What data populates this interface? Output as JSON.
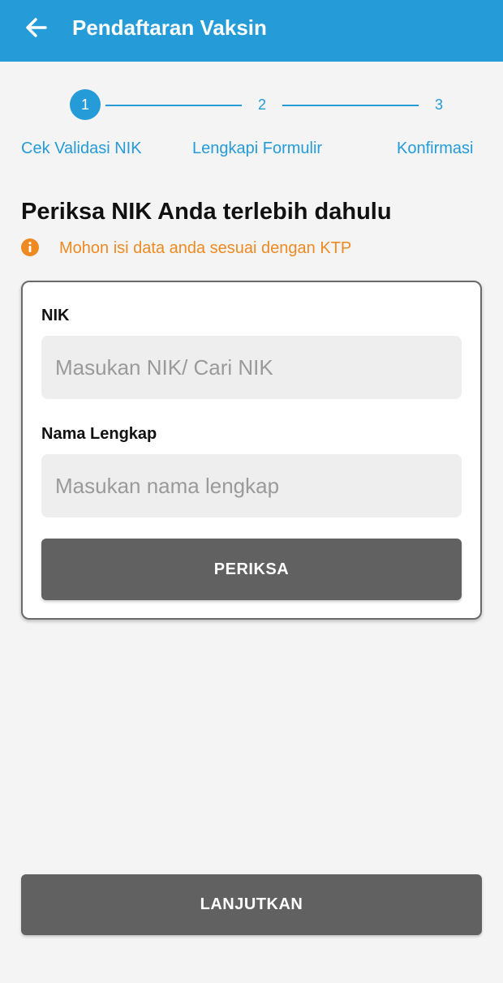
{
  "appbar": {
    "title": "Pendaftaran Vaksin",
    "back_icon": "arrow-left-icon",
    "color": "#259bd8"
  },
  "stepper": {
    "current_step": 1,
    "steps": [
      {
        "number": "1",
        "label": "Cek Validasi NIK"
      },
      {
        "number": "2",
        "label": "Lengkapi Formulir"
      },
      {
        "number": "3",
        "label": "Konfirmasi"
      }
    ]
  },
  "main": {
    "heading": "Periksa NIK Anda terlebih dahulu",
    "info": {
      "icon": "info-icon",
      "text": "Mohon isi data anda sesuai dengan KTP",
      "color": "#ef8a22"
    }
  },
  "form": {
    "nik": {
      "label": "NIK",
      "value": "",
      "placeholder": "Masukan NIK/ Cari NIK"
    },
    "name": {
      "label": "Nama Lengkap",
      "value": "",
      "placeholder": "Masukan nama lengkap"
    },
    "check_button": "PERIKSA"
  },
  "footer": {
    "next_button": "LANJUTKAN"
  }
}
